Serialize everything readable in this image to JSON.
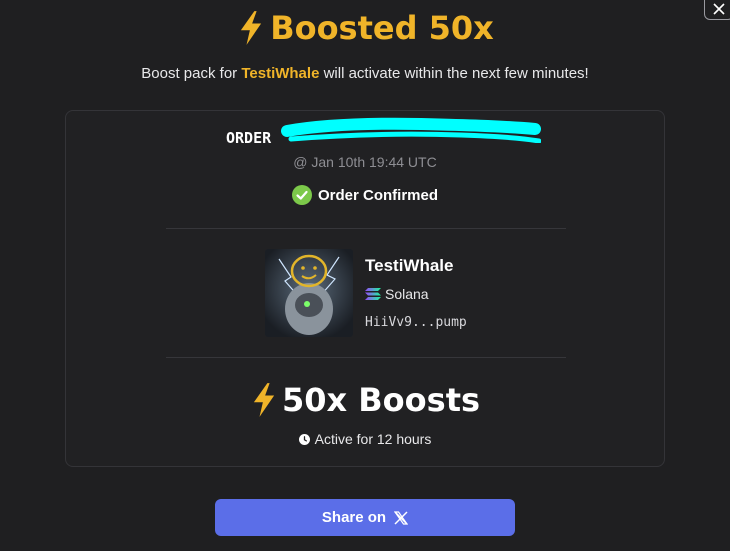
{
  "title": "Boosted 50x",
  "subtitle": {
    "prefix": "Boost pack for ",
    "token": "TestiWhale",
    "suffix": " will activate within the next few minutes!"
  },
  "order": {
    "label": "ORDER",
    "timestamp": "@ Jan 10th 19:44 UTC",
    "status": "Order Confirmed"
  },
  "token": {
    "name": "TestiWhale",
    "chain": "Solana",
    "address": "HiiVv9...pump"
  },
  "boost": {
    "amount": "50x Boosts",
    "duration": "Active for 12 hours"
  },
  "share": {
    "label": "Share on"
  },
  "colors": {
    "accent": "#f0b429",
    "confirm_green": "#7cc94a",
    "share_button": "#5b6ee8",
    "redaction": "#00ffff"
  }
}
